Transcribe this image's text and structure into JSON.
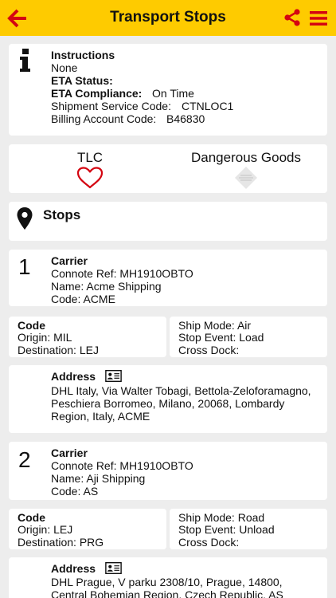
{
  "header": {
    "title": "Transport Stops"
  },
  "instructions": {
    "heading": "Instructions",
    "value": "None",
    "eta_status_label": "ETA Status:",
    "eta_compliance_label": "ETA Compliance:",
    "eta_compliance_value": "On Time",
    "service_code_label": "Shipment Service Code:",
    "service_code_value": "CTNLOC1",
    "billing_label": "Billing Account Code:",
    "billing_value": "B46830"
  },
  "flags": {
    "tlc_label": "TLC",
    "dg_label": "Dangerous Goods"
  },
  "stops_section": {
    "title": "Stops"
  },
  "stops": [
    {
      "number": "1",
      "carrier_heading": "Carrier",
      "connote": "Connote Ref: MH1910OBTO",
      "name": "Name: Acme Shipping",
      "code": "Code: ACME",
      "code_heading": "Code",
      "origin": "Origin: MIL",
      "destination": "Destination: LEJ",
      "ship_mode": "Ship Mode: Air",
      "stop_event": "Stop Event: Load",
      "cross_dock": "Cross Dock:",
      "address_heading": "Address",
      "address_lines": [
        "DHL Italy,  Via Walter Tobagi,  Bettola-Zeloforamagno,",
        "Peschiera Borromeo,  Milano,  20068,  Lombardy",
        "Region,  Italy,  ACME"
      ]
    },
    {
      "number": "2",
      "carrier_heading": "Carrier",
      "connote": "Connote Ref: MH1910OBTO",
      "name": "Name: Aji Shipping",
      "code": "Code: AS",
      "code_heading": "Code",
      "origin": "Origin: LEJ",
      "destination": "Destination: PRG",
      "ship_mode": "Ship Mode: Road",
      "stop_event": "Stop Event: Unload",
      "cross_dock": "Cross Dock:",
      "address_heading": "Address",
      "address_lines": [
        "DHL Prague,  V parku 2308/10,  Prague,  14800,",
        "Central Bohemian Region,  Czech Republic,  AS"
      ]
    }
  ],
  "colors": {
    "brand_yellow": "#fecb00",
    "brand_red": "#d40511",
    "background": "#ededed"
  }
}
